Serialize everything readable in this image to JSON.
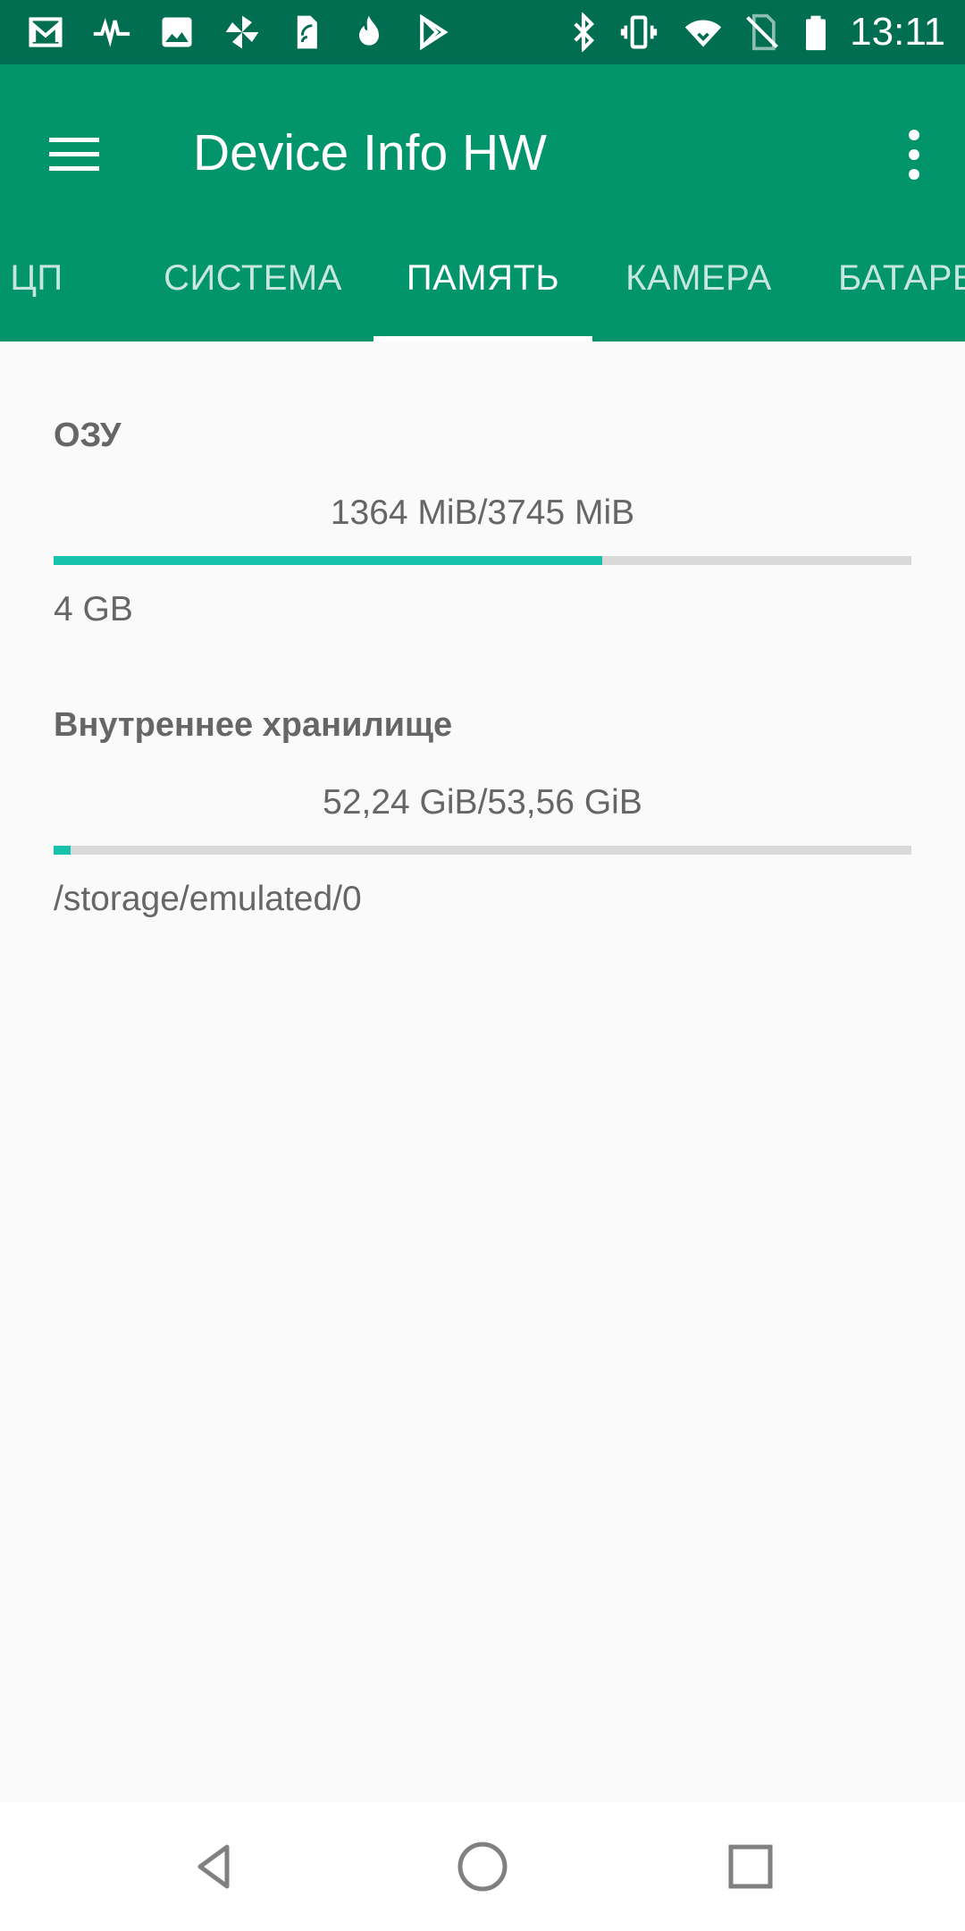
{
  "status_bar": {
    "time": "13:11",
    "left_icons": [
      "gmail-icon",
      "pulse-icon",
      "gallery-icon",
      "pinwheel-icon",
      "sim-card-icon",
      "flame-icon",
      "play-store-icon"
    ],
    "right_icons": [
      "bluetooth-icon",
      "vibrate-icon",
      "wifi-icon",
      "no-sim-icon",
      "battery-icon"
    ]
  },
  "app_bar": {
    "title": "Device Info HW",
    "menu_icon": "hamburger-menu-icon",
    "overflow_icon": "more-vert-icon"
  },
  "tabs": [
    {
      "label": "ЦП",
      "active": false
    },
    {
      "label": "СИСТЕМА",
      "active": false
    },
    {
      "label": "ПАМЯТЬ",
      "active": true
    },
    {
      "label": "КАМЕРА",
      "active": false
    },
    {
      "label": "БАТАРЕ",
      "active": false
    }
  ],
  "memory": {
    "ram": {
      "title": "ОЗУ",
      "usage": "1364 MiB/3745 MiB",
      "fraction": 0.64,
      "size_label": "4 GB"
    },
    "storage": {
      "title": "Внутреннее хранилище",
      "usage": "52,24 GiB/53,56 GiB",
      "fraction": 0.02,
      "path": "/storage/emulated/0"
    }
  },
  "colors": {
    "status_bar": "#016e52",
    "app_bar": "#02946a",
    "accent": "#17c2ad",
    "track": "#d9d9d9",
    "text": "#666666",
    "background": "#fafafa"
  },
  "nav_bar": {
    "buttons": [
      "back-icon",
      "home-icon",
      "recents-icon"
    ]
  }
}
